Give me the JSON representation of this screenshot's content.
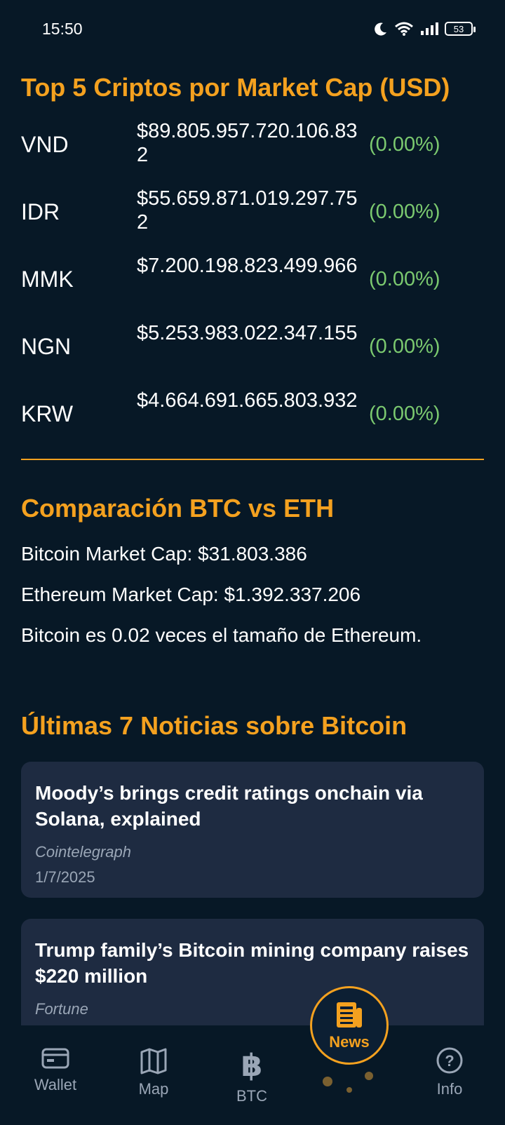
{
  "status_bar": {
    "time": "15:50",
    "battery": "53",
    "icons": [
      "moon-icon",
      "wifi-icon",
      "signal-icon",
      "battery-icon"
    ]
  },
  "top5": {
    "title": "Top 5 Criptos por Market Cap (USD)",
    "items": [
      {
        "code": "VND",
        "market_cap": "$89.805.957.720.106.832",
        "change": "(0.00%)"
      },
      {
        "code": "IDR",
        "market_cap": "$55.659.871.019.297.752",
        "change": "(0.00%)"
      },
      {
        "code": "MMK",
        "market_cap": "$7.200.198.823.499.966",
        "change": "(0.00%)"
      },
      {
        "code": "NGN",
        "market_cap": "$5.253.983.022.347.155",
        "change": "(0.00%)"
      },
      {
        "code": "KRW",
        "market_cap": "$4.664.691.665.803.932",
        "change": "(0.00%)"
      }
    ]
  },
  "comparison": {
    "title": "Comparación BTC vs ETH",
    "btc_line": "Bitcoin Market Cap: $31.803.386",
    "eth_line": "Ethereum Market Cap: $1.392.337.206",
    "ratio_line": "Bitcoin es 0.02 veces el tamaño de Ethereum."
  },
  "news": {
    "title": "Últimas 7 Noticias sobre Bitcoin",
    "items": [
      {
        "headline": "Moody’s brings credit ratings onchain via Solana, explained",
        "source": "Cointelegraph",
        "date": "1/7/2025"
      },
      {
        "headline": "Trump family’s Bitcoin mining company raises $220 million",
        "source": "Fortune",
        "date": ""
      }
    ]
  },
  "bottom_nav": {
    "wallet": "Wallet",
    "map": "Map",
    "btc": "BTC",
    "news": "News",
    "info": "Info"
  },
  "colors": {
    "background": "#071826",
    "accent": "#f4a11f",
    "positive": "#7bc96f",
    "card": "#1e2b41",
    "muted": "#9aa6b6"
  }
}
